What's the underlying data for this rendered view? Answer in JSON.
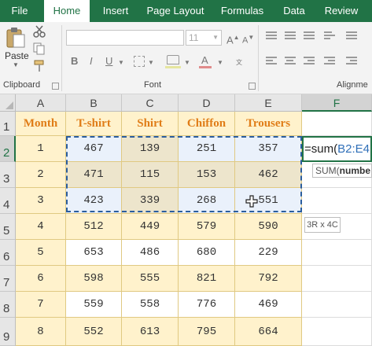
{
  "ribbon": {
    "tabs": [
      "File",
      "Home",
      "Insert",
      "Page Layout",
      "Formulas",
      "Data",
      "Review"
    ],
    "active_tab": "Home",
    "paste_label": "Paste",
    "font_size_value": "11",
    "groups": {
      "clipboard": "Clipboard",
      "font": "Font",
      "alignment": "Alignme"
    },
    "colors": {
      "brand": "#217346",
      "header_text": "#e07d18",
      "band_yellow": "#fff2cc",
      "band_blue": "#eaf1fb",
      "band_tan": "#ede5cc"
    }
  },
  "grid": {
    "columns": [
      "A",
      "B",
      "C",
      "D",
      "E",
      "F"
    ],
    "rows": [
      "1",
      "2",
      "3",
      "4",
      "5",
      "6",
      "7",
      "8",
      "9"
    ],
    "headers": [
      "Month",
      "T-shirt",
      "Shirt",
      "Chiffon",
      "Trousers"
    ],
    "data": [
      [
        "1",
        "467",
        "139",
        "251",
        "357"
      ],
      [
        "2",
        "471",
        "115",
        "153",
        "462"
      ],
      [
        "3",
        "423",
        "339",
        "268",
        "551"
      ],
      [
        "4",
        "512",
        "449",
        "579",
        "590"
      ],
      [
        "5",
        "653",
        "486",
        "680",
        "229"
      ],
      [
        "6",
        "598",
        "555",
        "821",
        "792"
      ],
      [
        "7",
        "559",
        "558",
        "776",
        "469"
      ],
      [
        "8",
        "552",
        "613",
        "795",
        "664"
      ]
    ]
  },
  "formula": {
    "prefix": "=sum(",
    "range": "B2:E4"
  },
  "tooltip": {
    "func": "SUM(",
    "arg": "numbe"
  },
  "size_hint": "3R x 4C"
}
